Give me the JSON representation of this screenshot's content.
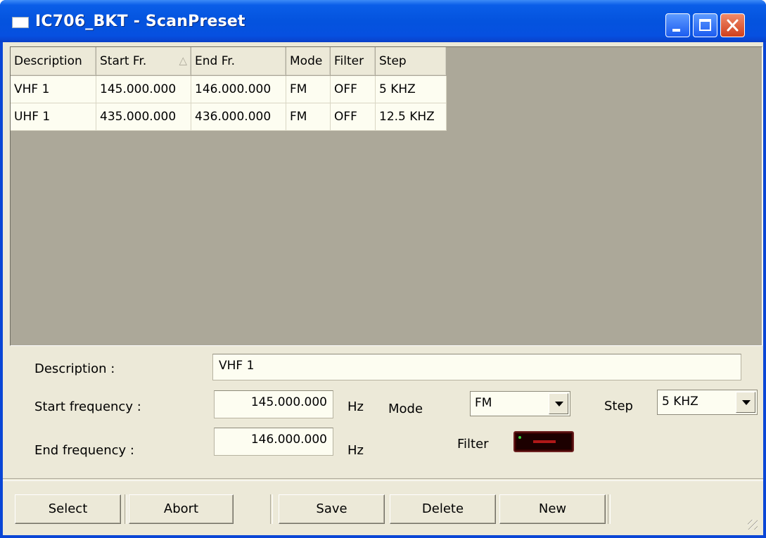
{
  "window": {
    "title": "IC706_BKT - ScanPreset"
  },
  "grid": {
    "columns": [
      "Description",
      "Start Fr.",
      "End Fr.",
      "Mode",
      "Filter",
      "Step"
    ],
    "sort_indicator": "△",
    "rows": [
      [
        "VHF 1",
        "145.000.000",
        "146.000.000",
        "FM",
        "OFF",
        "5 KHZ"
      ],
      [
        "UHF 1",
        "435.000.000",
        "436.000.000",
        "FM",
        "OFF",
        "12.5 KHZ"
      ]
    ]
  },
  "form": {
    "description_label": "Description :",
    "description_value": "VHF 1",
    "start_label": "Start frequency :",
    "start_value": "145.000.000",
    "start_unit": "Hz",
    "end_label": "End frequency :",
    "end_value": "146.000.000",
    "end_unit": "Hz",
    "mode_label": "Mode",
    "mode_value": "FM",
    "step_label": "Step",
    "step_value": "5 KHZ",
    "filter_label": "Filter",
    "filter_state": "off"
  },
  "buttons": {
    "select": "Select",
    "abort": "Abort",
    "save": "Save",
    "delete": "Delete",
    "new": "New"
  },
  "colors": {
    "titlebar": "#0453de",
    "client_bg": "#ece9d8",
    "grid_bg": "#aca899",
    "led_off": "#b01818"
  }
}
